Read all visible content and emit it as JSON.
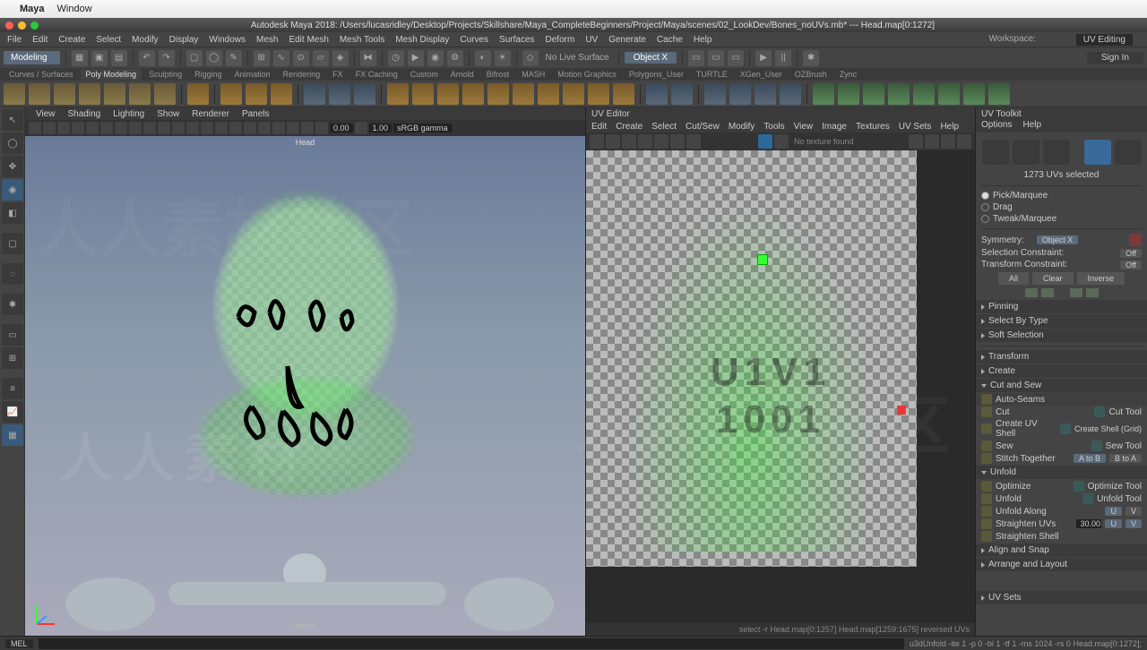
{
  "mac": {
    "app": "Maya",
    "menu1": "Window"
  },
  "title": "Autodesk Maya 2018: /Users/lucasridley/Desktop/Projects/Skillshare/Maya_CompleteBeginners/Project/Maya/scenes/02_LookDev/Bones_noUVs.mb*   ---   Head.map[0:1272]",
  "menubar": [
    "File",
    "Edit",
    "Create",
    "Select",
    "Modify",
    "Display",
    "Windows",
    "Mesh",
    "Edit Mesh",
    "Mesh Tools",
    "Mesh Display",
    "Curves",
    "Surfaces",
    "Deform",
    "UV",
    "Generate",
    "Cache",
    "Help"
  ],
  "mode": "Modeling",
  "live_surface": "No Live Surface",
  "object_dd": "Object X",
  "workspace_lbl": "Workspace:",
  "workspace_dd": "UV Editing",
  "signin": "Sign In",
  "shelf_tabs": [
    "Curves / Surfaces",
    "Poly Modeling",
    "Sculpting",
    "Rigging",
    "Animation",
    "Rendering",
    "FX",
    "FX Caching",
    "Custom",
    "Arnold",
    "Bifrost",
    "MASH",
    "Motion Graphics",
    "Polygons_User",
    "TURTLE",
    "XGen_User",
    "OZBrush",
    "Zync"
  ],
  "viewport_menu": [
    "View",
    "Shading",
    "Lighting",
    "Show",
    "Renderer",
    "Panels"
  ],
  "vp_num1": "0.00",
  "vp_num2": "1.00",
  "vp_gamma": "sRGB gamma",
  "vp_top_label": "Head",
  "persp": "persp",
  "uv_title": "UV Editor",
  "uv_menu": [
    "Edit",
    "Create",
    "Select",
    "Cut/Sew",
    "Modify",
    "Tools",
    "View",
    "Image",
    "Textures",
    "UV Sets",
    "Help"
  ],
  "uv_no_tex": "No texture found",
  "uv_overlay_1": "U1V1",
  "uv_overlay_2": "1001",
  "uv_status": "select -r Head.map[0:1257] Head.map[1259:1675] reversed UVs",
  "toolkit": {
    "title": "UV Toolkit",
    "menu": [
      "Options",
      "Help"
    ],
    "count": "1273 UVs selected",
    "pick": "Pick/Marquee",
    "drag": "Drag",
    "tweak": "Tweak/Marquee",
    "symmetry": "Symmetry:",
    "sym_val": "Object X",
    "sel_con": "Selection Constraint:",
    "sel_off": "Off",
    "trans_con": "Transform Constraint:",
    "trans_off": "Off",
    "all": "All",
    "clear": "Clear",
    "inverse": "Inverse",
    "pinning": "Pinning",
    "selbytype": "Select By Type",
    "softsel": "Soft Selection",
    "transform": "Transform",
    "create": "Create",
    "cutsew": "Cut and Sew",
    "autoseams": "Auto-Seams",
    "cut": "Cut",
    "cuttool": "Cut Tool",
    "createshell": "Create UV Shell",
    "createshellgrid": "Create Shell (Grid)",
    "sew": "Sew",
    "sewtool": "Sew Tool",
    "stitch": "Stitch Together",
    "atob": "A to B",
    "btoa": "B to A",
    "unfold": "Unfold",
    "optimize": "Optimize",
    "optimizetool": "Optimize Tool",
    "unfold2": "Unfold",
    "unfoldtool": "Unfold Tool",
    "unfoldalong": "Unfold Along",
    "u": "U",
    "v": "V",
    "straighten": "Straighten UVs",
    "straighten_val": "30.00",
    "straightenshell": "Straighten Shell",
    "alignsnap": "Align and Snap",
    "arrange": "Arrange and Layout",
    "uvsets": "UV Sets"
  },
  "cmd": {
    "mel": "MEL",
    "out": "u3dUnfold -ite 1 -p 0 -bi 1 -tf 1 -ms 1024 -rs 0 Head.map[0:1272];"
  }
}
